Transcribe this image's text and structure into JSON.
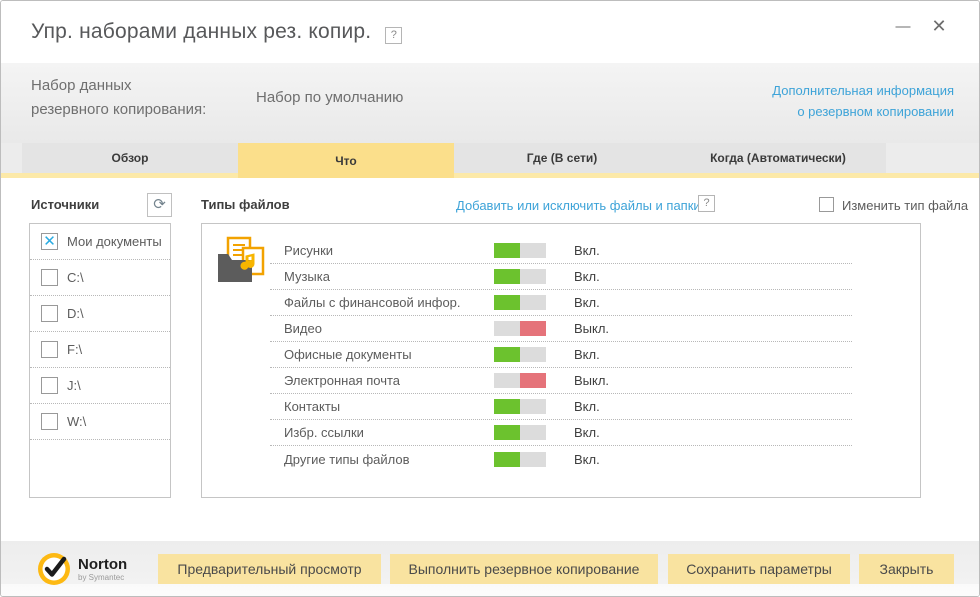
{
  "window": {
    "title": "Упр. наборами данных рез. копир.",
    "help": "?"
  },
  "icons": {
    "minimize": "—",
    "close": "✕",
    "help": "?",
    "refresh": "⟳",
    "checked_x": "✕"
  },
  "header": {
    "label_line1": "Набор данных",
    "label_line2": "резервного копирования:",
    "value": "Набор по умолчанию",
    "link_line1": "Дополнительная информация",
    "link_line2": "о резервном копировании"
  },
  "tabs": [
    {
      "name": "tab-overview",
      "label": "Обзор",
      "active": false
    },
    {
      "name": "tab-what",
      "label": "Что",
      "active": true
    },
    {
      "name": "tab-where",
      "label": "Где (В сети)",
      "active": false
    },
    {
      "name": "tab-when",
      "label": "Когда (Автоматически)",
      "active": false
    }
  ],
  "sources": {
    "title": "Источники",
    "items": [
      {
        "label": "Мои документы",
        "checked": true
      },
      {
        "label": "C:\\",
        "checked": false
      },
      {
        "label": "D:\\",
        "checked": false
      },
      {
        "label": "F:\\",
        "checked": false
      },
      {
        "label": "J:\\",
        "checked": false
      },
      {
        "label": "W:\\",
        "checked": false
      }
    ]
  },
  "filetypes": {
    "title": "Типы файлов",
    "add_link": "Добавить или исключить файлы и папки",
    "help": "?",
    "edit_checkbox_label": "Изменить тип файла",
    "edit_checkbox_checked": false,
    "rows": [
      {
        "label": "Рисунки",
        "state": "on",
        "status": "Вкл."
      },
      {
        "label": "Музыка",
        "state": "on",
        "status": "Вкл."
      },
      {
        "label": "Файлы с финансовой инфор.",
        "state": "on",
        "status": "Вкл."
      },
      {
        "label": "Видео",
        "state": "off",
        "status": "Выкл."
      },
      {
        "label": "Офисные документы",
        "state": "on",
        "status": "Вкл."
      },
      {
        "label": "Электронная почта",
        "state": "off",
        "status": "Выкл."
      },
      {
        "label": "Контакты",
        "state": "on",
        "status": "Вкл."
      },
      {
        "label": "Избр. ссылки",
        "state": "on",
        "status": "Вкл."
      },
      {
        "label": "Другие типы файлов",
        "state": "on",
        "status": "Вкл."
      }
    ]
  },
  "footer": {
    "brand": "Norton",
    "brand_sub": "by Symantec",
    "buttons": [
      {
        "name": "preview-button",
        "label": "Предварительный просмотр"
      },
      {
        "name": "run-backup-button",
        "label": "Выполнить резервное копирование"
      },
      {
        "name": "save-settings-button",
        "label": "Сохранить параметры"
      },
      {
        "name": "close-button",
        "label": "Закрыть"
      }
    ]
  },
  "colors": {
    "active_tab_yellow": "#fbdf8b",
    "tab_underline_yellow": "#fce9a8",
    "button_yellow": "#f9e3a0",
    "toggle_on_green": "#6cc22e",
    "toggle_off_red": "#e5737a",
    "toggle_gray": "#dcdcdc",
    "link_blue": "#3da3d8",
    "checkbox_x_blue": "#29abe2",
    "norton_yellow": "#fdb913"
  }
}
